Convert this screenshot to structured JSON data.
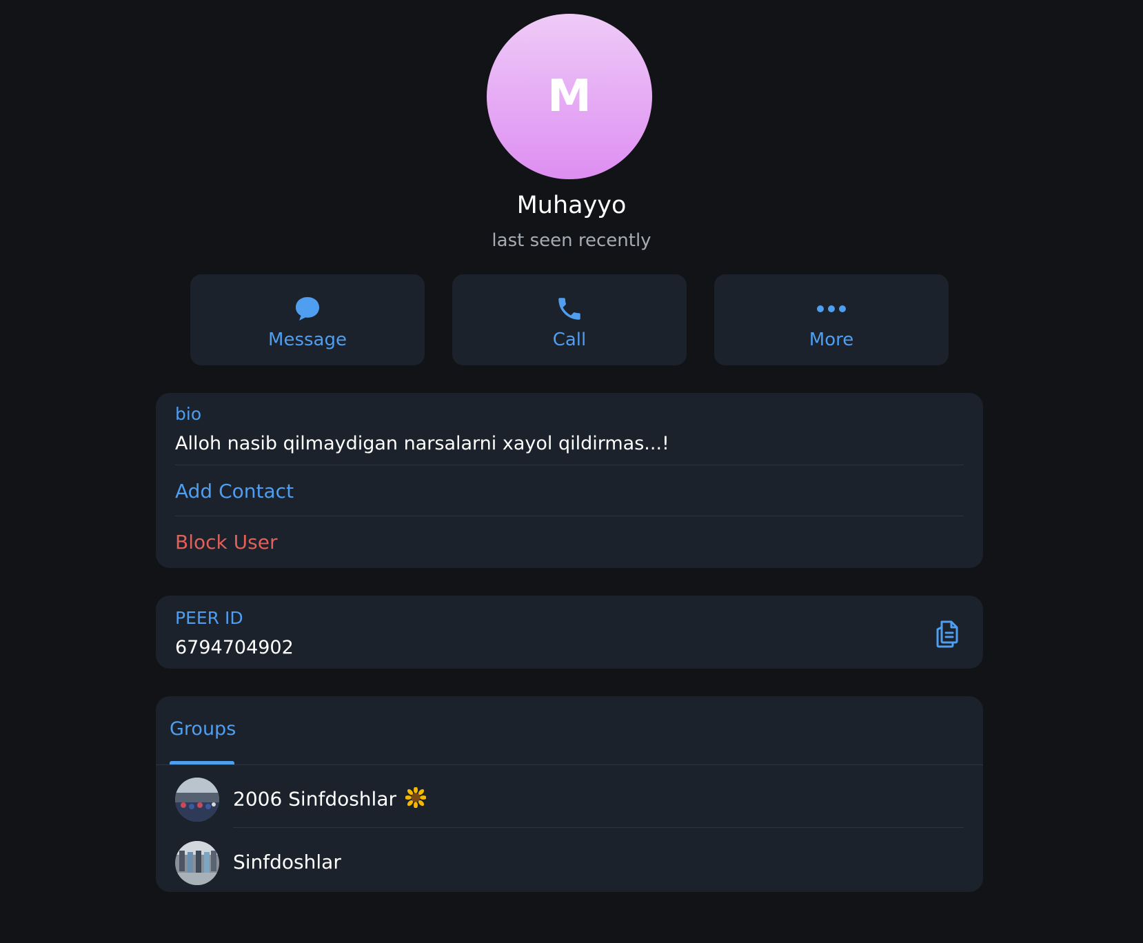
{
  "profile": {
    "avatar_letter": "M",
    "name": "Muhayyo",
    "status": "last seen recently"
  },
  "actions": [
    {
      "label": "Message",
      "icon": "message-bubble-icon"
    },
    {
      "label": "Call",
      "icon": "phone-icon"
    },
    {
      "label": "More",
      "icon": "more-dots-icon"
    }
  ],
  "info": {
    "bio_label": "bio",
    "bio_text": "Alloh nasib qilmaydigan narsalarni xayol qildirmas...!",
    "add_contact": "Add Contact",
    "block_user": "Block User"
  },
  "peer": {
    "label": "PEER ID",
    "value": "6794704902",
    "copy_icon": "copy-icon"
  },
  "groups": {
    "tab_label": "Groups",
    "items": [
      {
        "name": "2006 Sinfdoshlar",
        "emoji_icon": "sunflower-icon"
      },
      {
        "name": "Sinfdoshlar"
      }
    ]
  },
  "colors": {
    "background": "#121316",
    "card": "#1b222b",
    "accent": "#4f9ef0",
    "danger": "#e0605b",
    "avatar_top": "#eecbf7",
    "avatar_bottom": "#de8ef2"
  }
}
